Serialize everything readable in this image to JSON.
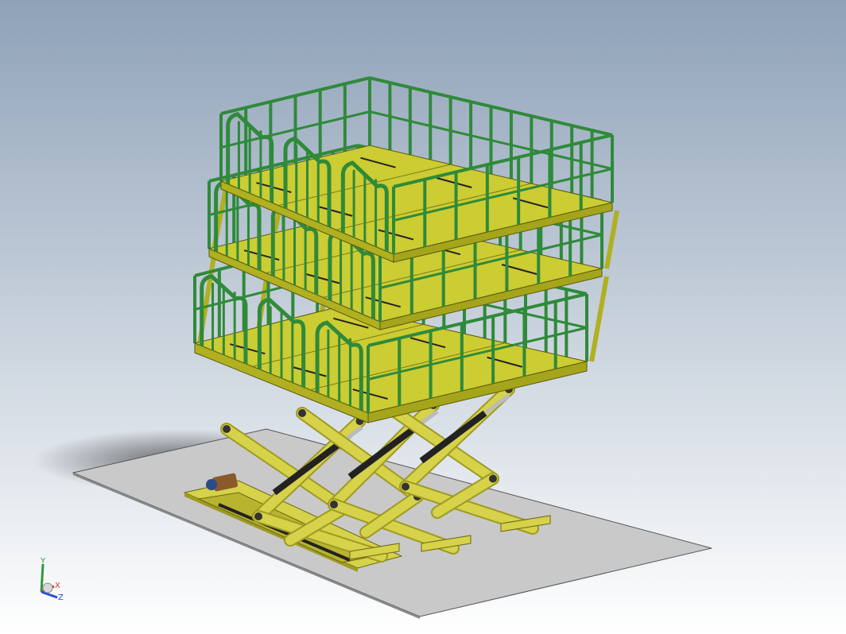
{
  "viewport": {
    "background_top": "#8fa2b8",
    "background_bottom": "#ffffff"
  },
  "colors": {
    "platform_top": "#cccc33",
    "platform_edge": "#b0b020",
    "rail": "#2f8a3a",
    "scissor": "#d6d24a",
    "scissor_dark": "#9e9a22",
    "floor": "#c9c9c9",
    "cylinder": "#222222",
    "motor": "#8a5a2b"
  },
  "triad": {
    "x_label": "X",
    "y_label": "Y",
    "z_label": "Z",
    "x_color": "#d23a2a",
    "y_color": "#2f9a3a",
    "z_color": "#2a4fd2"
  }
}
